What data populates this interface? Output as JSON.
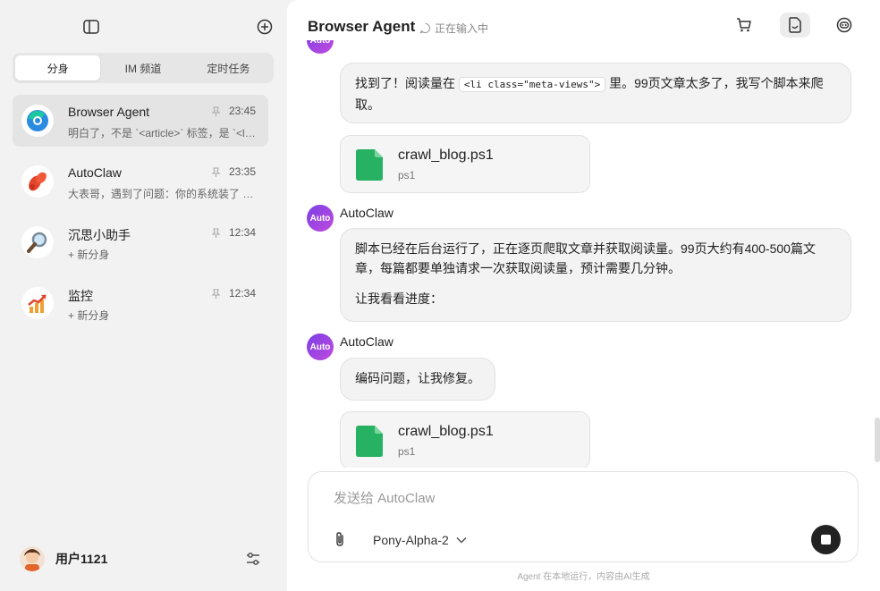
{
  "sidebar": {
    "tabs": [
      {
        "label": "分身",
        "active": true
      },
      {
        "label": "IM 频道",
        "active": false
      },
      {
        "label": "定时任务",
        "active": false
      }
    ],
    "conversations": [
      {
        "name": "Browser Agent",
        "time": "23:45",
        "preview": "明白了，不是 `<article>` 标签，是 `<li class=\"meta-views\">`",
        "avatar": "browser-agent-logo",
        "active": true
      },
      {
        "name": "AutoClaw",
        "time": "23:35",
        "preview": "大表哥，遇到了问题：你的系统装了 PowerShell，但脚本编码有误",
        "avatar": "lobster-claw-logo",
        "active": false
      },
      {
        "name": "沉思小助手",
        "time": "12:34",
        "preview": "+ 新分身",
        "avatar": "magnifier-logo",
        "active": false
      },
      {
        "name": "监控",
        "time": "12:34",
        "preview": "+ 新分身",
        "avatar": "growth-chart-logo",
        "active": false
      }
    ],
    "user": {
      "name": "用户1121"
    }
  },
  "header": {
    "title": "Browser Agent",
    "status": "正在输入中"
  },
  "messages": {
    "m1": {
      "text_before": "找到了！阅读量在",
      "code": "<li class=\"meta-views\">",
      "text_after": "里。99页文章太多了，我写个脚本来爬取。"
    },
    "file1": {
      "name": "crawl_blog.ps1",
      "ext": "ps1"
    },
    "m2": {
      "avatar_label": "Auto",
      "sender": "AutoClaw",
      "para1": "脚本已经在后台运行了，正在逐页爬取文章并获取阅读量。99页大约有400-500篇文章，每篇都要单独请求一次获取阅读量，预计需要几分钟。",
      "para2": "让我看看进度："
    },
    "m3": {
      "avatar_label": "Auto",
      "sender": "AutoClaw",
      "text": "编码问题，让我修复。"
    },
    "file2": {
      "name": "crawl_blog.ps1",
      "ext": "ps1"
    },
    "top_avatar_label": "Auto"
  },
  "composer": {
    "placeholder": "发送给 AutoClaw",
    "value": "",
    "model": "Pony-Alpha-2"
  },
  "footer": "Agent 在本地运行，内容由AI生成",
  "colors": {
    "accent": "#8a44e2",
    "file_icon": "#27b163"
  }
}
